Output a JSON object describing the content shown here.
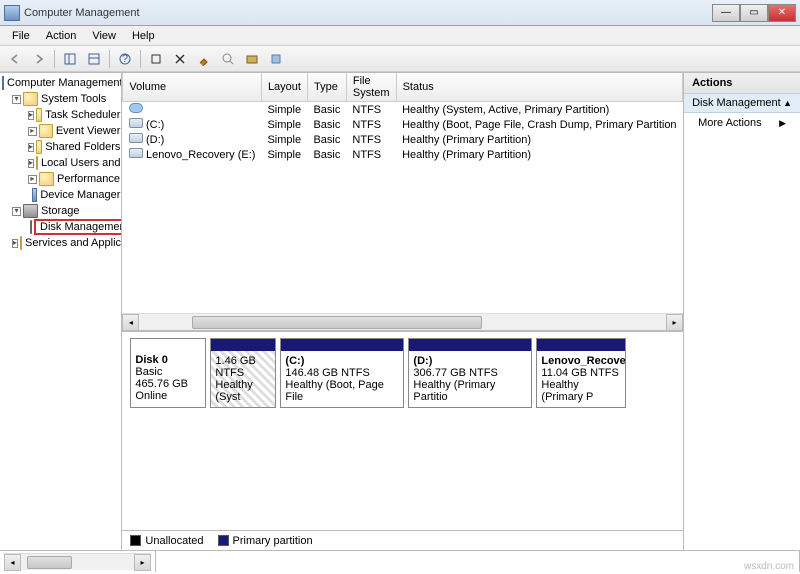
{
  "window": {
    "title": "Computer Management"
  },
  "menu": {
    "file": "File",
    "action": "Action",
    "view": "View",
    "help": "Help"
  },
  "tree": {
    "root": "Computer Management (Local",
    "system_tools": "System Tools",
    "task_scheduler": "Task Scheduler",
    "event_viewer": "Event Viewer",
    "shared_folders": "Shared Folders",
    "local_users": "Local Users and Groups",
    "performance": "Performance",
    "device_manager": "Device Manager",
    "storage": "Storage",
    "disk_management": "Disk Management",
    "services_apps": "Services and Applications"
  },
  "columns": {
    "volume": "Volume",
    "layout": "Layout",
    "type": "Type",
    "filesystem": "File System",
    "status": "Status"
  },
  "volumes": [
    {
      "name": "",
      "layout": "Simple",
      "type": "Basic",
      "fs": "NTFS",
      "status": "Healthy (System, Active, Primary Partition)"
    },
    {
      "name": "(C:)",
      "layout": "Simple",
      "type": "Basic",
      "fs": "NTFS",
      "status": "Healthy (Boot, Page File, Crash Dump, Primary Partition"
    },
    {
      "name": "(D:)",
      "layout": "Simple",
      "type": "Basic",
      "fs": "NTFS",
      "status": "Healthy (Primary Partition)"
    },
    {
      "name": "Lenovo_Recovery (E:)",
      "layout": "Simple",
      "type": "Basic",
      "fs": "NTFS",
      "status": "Healthy (Primary Partition)"
    }
  ],
  "disk0": {
    "label": "Disk 0",
    "type": "Basic",
    "size": "465.76 GB",
    "state": "Online",
    "parts": [
      {
        "name": "",
        "size": "1.46 GB NTFS",
        "status": "Healthy (Syst"
      },
      {
        "name": "(C:)",
        "size": "146.48 GB NTFS",
        "status": "Healthy (Boot, Page File"
      },
      {
        "name": "(D:)",
        "size": "306.77 GB NTFS",
        "status": "Healthy (Primary Partitio"
      },
      {
        "name": "Lenovo_Recovery",
        "size": "11.04 GB NTFS",
        "status": "Healthy (Primary P"
      }
    ]
  },
  "legend": {
    "unallocated": "Unallocated",
    "primary": "Primary partition"
  },
  "actions": {
    "header": "Actions",
    "subheader": "Disk Management",
    "more": "More Actions"
  },
  "watermark": "wsxdn.com"
}
